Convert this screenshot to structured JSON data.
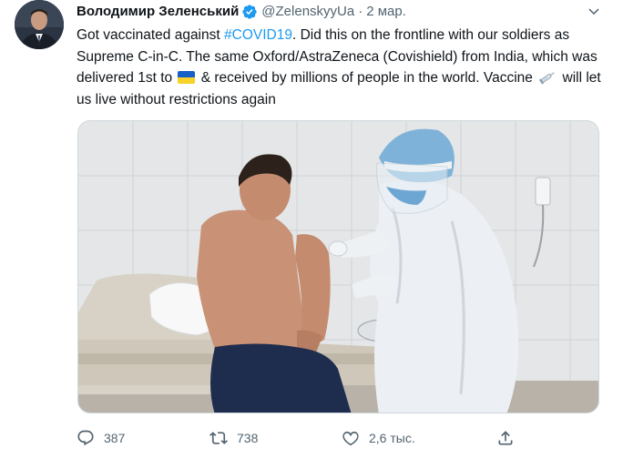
{
  "author": {
    "display_name": "Володимир Зеленський",
    "handle": "@ZelenskyyUa",
    "separator": "·",
    "date": "2 мар.",
    "verified": true
  },
  "tweet": {
    "text_part1": "Got vaccinated against ",
    "hashtag": "#COVID19",
    "text_part2": ". Did this on the frontline with our soldiers as Supreme C-in-C. The same Oxford/AstraZeneca (Covishield) from India, which was delivered 1st to ",
    "flag_emoji": "ukraine-flag",
    "text_part3": " & received by millions of people in the world. Vaccine ",
    "syringe_emoji": "syringe",
    "text_part4": " will let us live without restrictions again"
  },
  "media": {
    "subject": "man-receiving-vaccine-photo"
  },
  "actions": {
    "reply_count": "387",
    "retweet_count": "738",
    "like_count": "2,6 тыс.",
    "share_icon": "share-icon"
  },
  "colors": {
    "accent": "#1d9bf0",
    "secondary_text": "#536471",
    "primary_text": "#0f1419"
  }
}
